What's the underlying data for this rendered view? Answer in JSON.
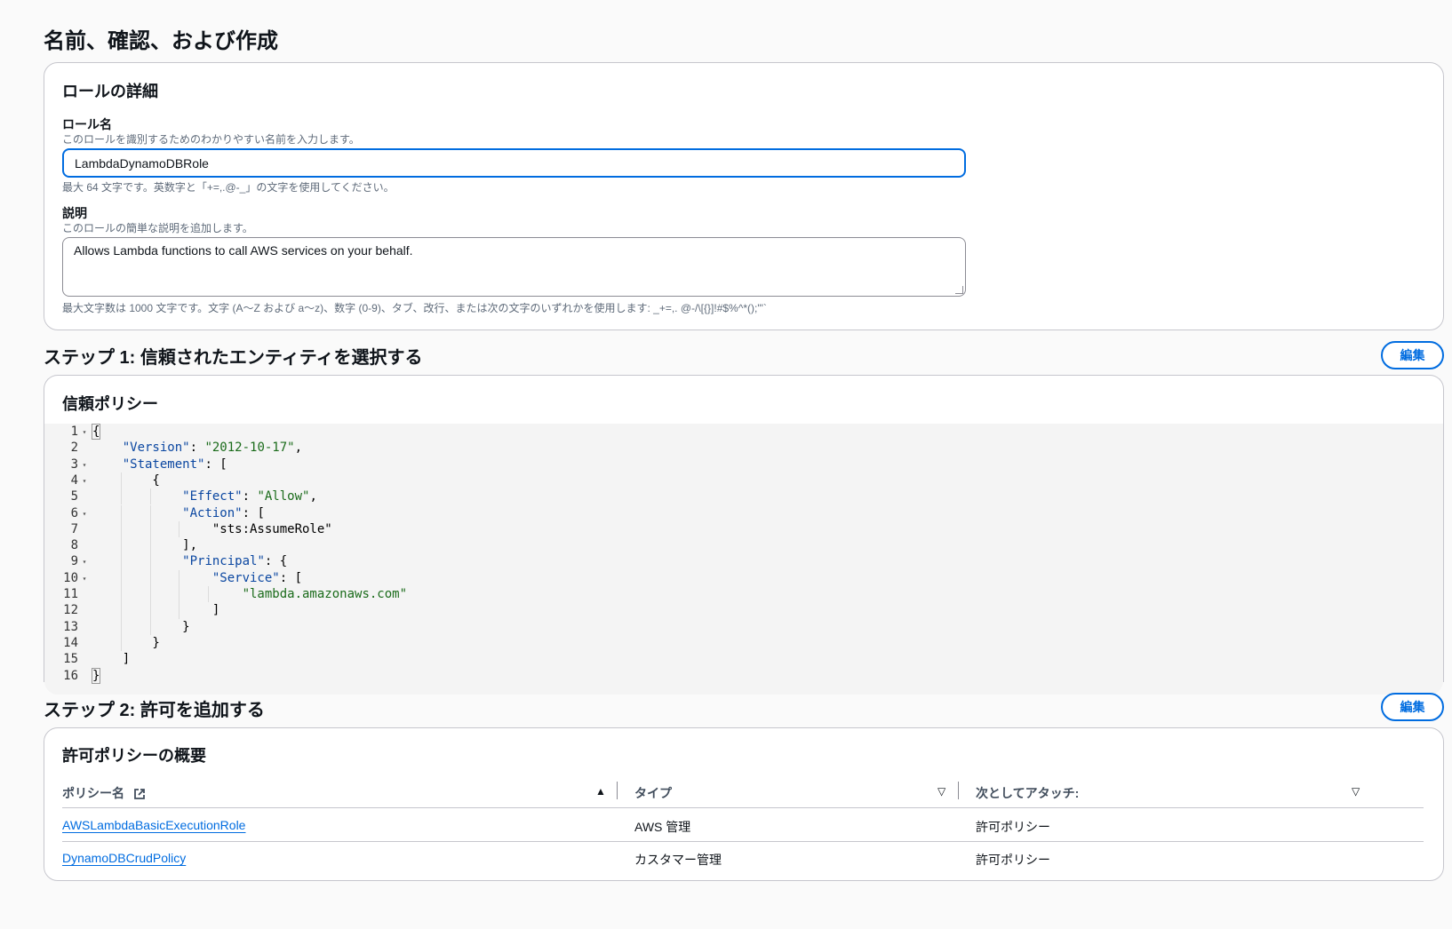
{
  "page": {
    "title": "名前、確認、および作成"
  },
  "role_details": {
    "title": "ロールの詳細",
    "name_label": "ロール名",
    "name_desc": "このロールを識別するためのわかりやすい名前を入力します。",
    "name_value": "LambdaDynamoDBRole",
    "name_hint": "最大 64 文字です。英数字と「+=,.@-_」の文字を使用してください。",
    "desc_label": "説明",
    "desc_desc": "このロールの簡単な説明を追加します。",
    "desc_value": "Allows Lambda functions to call AWS services on your behalf.",
    "desc_hint": "最大文字数は 1000 文字です。文字 (A〜Z および a〜z)、数字 (0-9)、タブ、改行、または次の文字のいずれかを使用します: _+=,. @-/\\[{}]!#$%^*();\"'`"
  },
  "step1": {
    "heading": "ステップ 1: 信頼されたエンティティを選択する",
    "edit_label": "編集",
    "card_title": "信頼ポリシー",
    "code_lines": [
      "{",
      "    \"Version\": \"2012-10-17\",",
      "    \"Statement\": [",
      "        {",
      "            \"Effect\": \"Allow\",",
      "            \"Action\": [",
      "                \"sts:AssumeRole\"",
      "            ],",
      "            \"Principal\": {",
      "                \"Service\": [",
      "                    \"lambda.amazonaws.com\"",
      "                ]",
      "            }",
      "        }",
      "    ]",
      "}"
    ],
    "line_numbers": [
      "1",
      "2",
      "3",
      "4",
      "5",
      "6",
      "7",
      "8",
      "9",
      "10",
      "11",
      "12",
      "13",
      "14",
      "15",
      "16"
    ]
  },
  "step2": {
    "heading": "ステップ 2: 許可を追加する",
    "edit_label": "編集",
    "card_title": "許可ポリシーの概要",
    "columns": [
      "ポリシー名",
      "タイプ",
      "次としてアタッチ:"
    ],
    "rows": [
      {
        "name": "AWSLambdaBasicExecutionRole",
        "type": "AWS 管理",
        "attach": "許可ポリシー"
      },
      {
        "name": "DynamoDBCrudPolicy",
        "type": "カスタマー管理",
        "attach": "許可ポリシー"
      }
    ]
  },
  "colors": {
    "accent": "#006ce0",
    "code_key": "#0b47a1",
    "code_string": "#1a6b1a"
  }
}
